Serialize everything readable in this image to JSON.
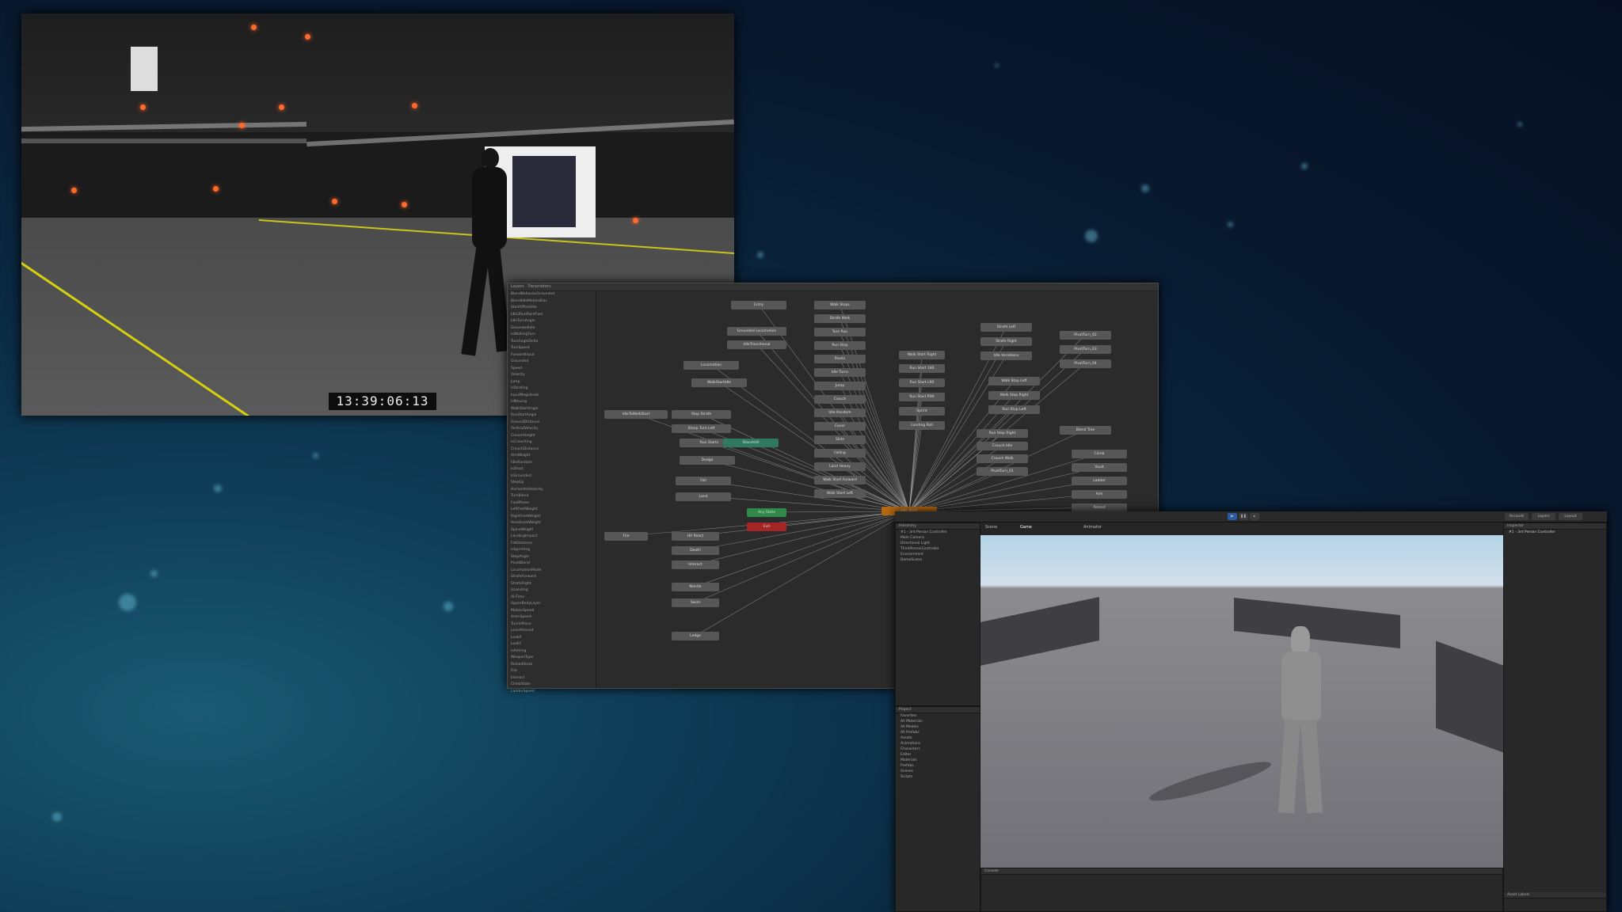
{
  "video": {
    "timecode": "13:39:06:13"
  },
  "graph": {
    "top_tabs": [
      "Layers",
      "Parameters"
    ],
    "parameters": [
      "BlendBehaviorGrounded",
      "BlendIdleMotionBias",
      "StartOffsetIdle",
      "Idle2RunPointFwd",
      "IdleTurnAngle",
      "GroundedIdle",
      "IsWalkingTurn",
      "TurnAngleDelta",
      "TurnSpeed",
      "ForwardInput",
      "Grounded",
      "Speed",
      "Velocity",
      "Jump",
      "IsStrafing",
      "InputMagnitude",
      "IsMoving",
      "WalkStartAngle",
      "RunStartAngle",
      "GroundDistance",
      "VerticalVelocity",
      "CrouchHeight",
      "IsCrouching",
      "CrouchDistance",
      "AimWeight",
      "IdleRandom",
      "IsDead",
      "IsGrounded",
      "StepUp",
      "HorizontalVelocity",
      "TurnBlend",
      "FootPhase",
      "LeftFootWeight",
      "RightFootWeight",
      "HeadLookWeight",
      "SpineWeight",
      "LandingImpact",
      "FallDistance",
      "IsSprinting",
      "StopAngle",
      "PivotBlend",
      "LocomotionMode",
      "StrafeForward",
      "StrafeRight",
      "IsLanding",
      "AirTime",
      "UpperBodyLayer",
      "MotionSpeed",
      "AnimSpeed",
      "TurnInPlace",
      "LeanAmount",
      "LookX",
      "LookY",
      "IsAiming",
      "WeaponType",
      "ReloadState",
      "Fire",
      "Interact",
      "ClimbState",
      "LadderSpeed"
    ],
    "nodes": {
      "entry": "Entry",
      "anyState": "Any State",
      "exit": "Exit",
      "idle": "Idle Start",
      "n1": "Grounded Locomotion",
      "n2": "IdleTransitional",
      "n3": "Locomotion",
      "n4": "WalkStartIdle",
      "n5": "IdleToWalkStart",
      "n6": "Stop Strafe",
      "n7": "Sharp Turn Left",
      "n8": "Run Starts",
      "n9": "Standstill",
      "n10": "Dodge",
      "n11": "Fall",
      "n12": "Land",
      "n13": "Walk Stops",
      "n14": "Strafe Walk",
      "n15": "Turn Run",
      "n16": "Run Stop",
      "n17": "Pivots",
      "n18": "Idle Turns",
      "n19": "Jump",
      "n20": "Crouch",
      "n21": "Idle Random",
      "n22": "Cover",
      "n23": "Slide",
      "n24": "Falling",
      "n25": "Land Heavy",
      "n26": "Walk Start Forward",
      "n27": "Walk Start Left",
      "n28": "Walk Start Right",
      "n29": "Run Start 180",
      "n30": "Run Start L90",
      "n31": "Run Start R90",
      "n32": "Sprint",
      "n33": "Landing Roll",
      "n34": "Strafe Left",
      "n35": "Strafe Right",
      "n36": "Idle Variations",
      "n37": "Walk Stop Left",
      "n38": "Walk Stop Right",
      "n39": "Run Stop Left",
      "n40": "Run Stop Right",
      "n41": "Crouch Idle",
      "n42": "Crouch Walk",
      "n43": "PivotTurn_01",
      "n44": "PivotTurn_02",
      "n45": "PivotTurn_03",
      "n46": "PivotTurn_04",
      "n47": "Blend Tree",
      "n48": "Climb",
      "n49": "Vault",
      "n50": "Ladder",
      "n51": "Aim",
      "n52": "Reload",
      "n53": "Fire",
      "n54": "Hit React",
      "n55": "Death",
      "n56": "Interact",
      "n57": "Mantle",
      "n58": "Swim",
      "n59": "Ledge"
    }
  },
  "unity": {
    "hierarchy_title": "Hierarchy",
    "hierarchy": [
      "#1 - 3rd Person Controller",
      "Main Camera",
      "Directional Light",
      "ThirdPersonController",
      "Environment",
      "DemoScene"
    ],
    "scene_tabs": [
      "Scene",
      "Game",
      "Animator"
    ],
    "project_title": "Project",
    "project": [
      "Favorites",
      "All Materials",
      "All Models",
      "All Prefabs",
      "Assets",
      "Animations",
      "Characters",
      "Editor",
      "Materials",
      "Prefabs",
      "Scenes",
      "Scripts"
    ],
    "inspector_title": "Inspector",
    "inspector_object": "#1 - 3rd Person Controller",
    "console_title": "Console",
    "asset_labels": "Asset Labels",
    "toolbar": [
      "Layers",
      "Layout",
      "Account"
    ]
  }
}
